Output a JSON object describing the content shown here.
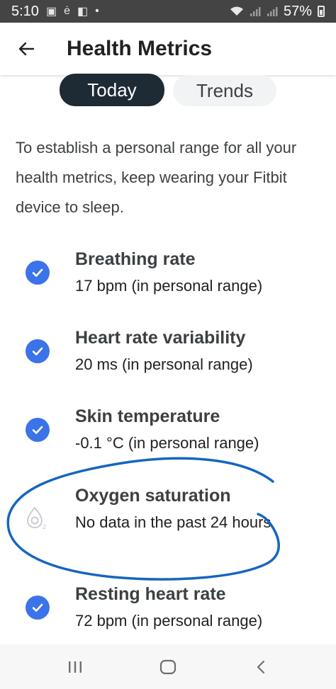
{
  "status_bar": {
    "time": "5:10",
    "battery": "57%",
    "icons": [
      "image-icon",
      "e-icon",
      "flipboard-icon",
      "dot-icon",
      "wifi-icon",
      "signal-icon",
      "signal-icon",
      "battery-icon"
    ]
  },
  "header": {
    "title": "Health Metrics",
    "back_icon": "arrow-left-icon"
  },
  "tabs": [
    {
      "label": "Today",
      "selected": true
    },
    {
      "label": "Trends",
      "selected": false
    }
  ],
  "intro_text": "To establish a personal range for all your health metrics, keep wearing your Fitbit device to sleep.",
  "metrics": [
    {
      "name": "Breathing rate",
      "value": "17 bpm (in personal range)",
      "icon": "check-circle-icon"
    },
    {
      "name": "Heart rate variability",
      "value": "20 ms (in personal range)",
      "icon": "check-circle-icon"
    },
    {
      "name": "Skin temperature",
      "value": "-0.1 °C (in personal range)",
      "icon": "check-circle-icon"
    },
    {
      "name": "Oxygen saturation",
      "value": "No data in the past 24 hours",
      "icon": "o2-drop-icon",
      "o2_symbol": "O2"
    },
    {
      "name": "Resting heart rate",
      "value": "72 bpm (in personal range)",
      "icon": "check-circle-icon"
    }
  ],
  "nav_bar": {
    "icons": [
      "recents-icon",
      "home-icon",
      "back-icon"
    ]
  },
  "colors": {
    "check": "#3b73e8",
    "tab_selected_bg": "#1e2b35",
    "tab_unselected_bg": "#f1f3f4",
    "annotation_stroke": "#1565c0",
    "status_bar_bg": "#444444"
  }
}
